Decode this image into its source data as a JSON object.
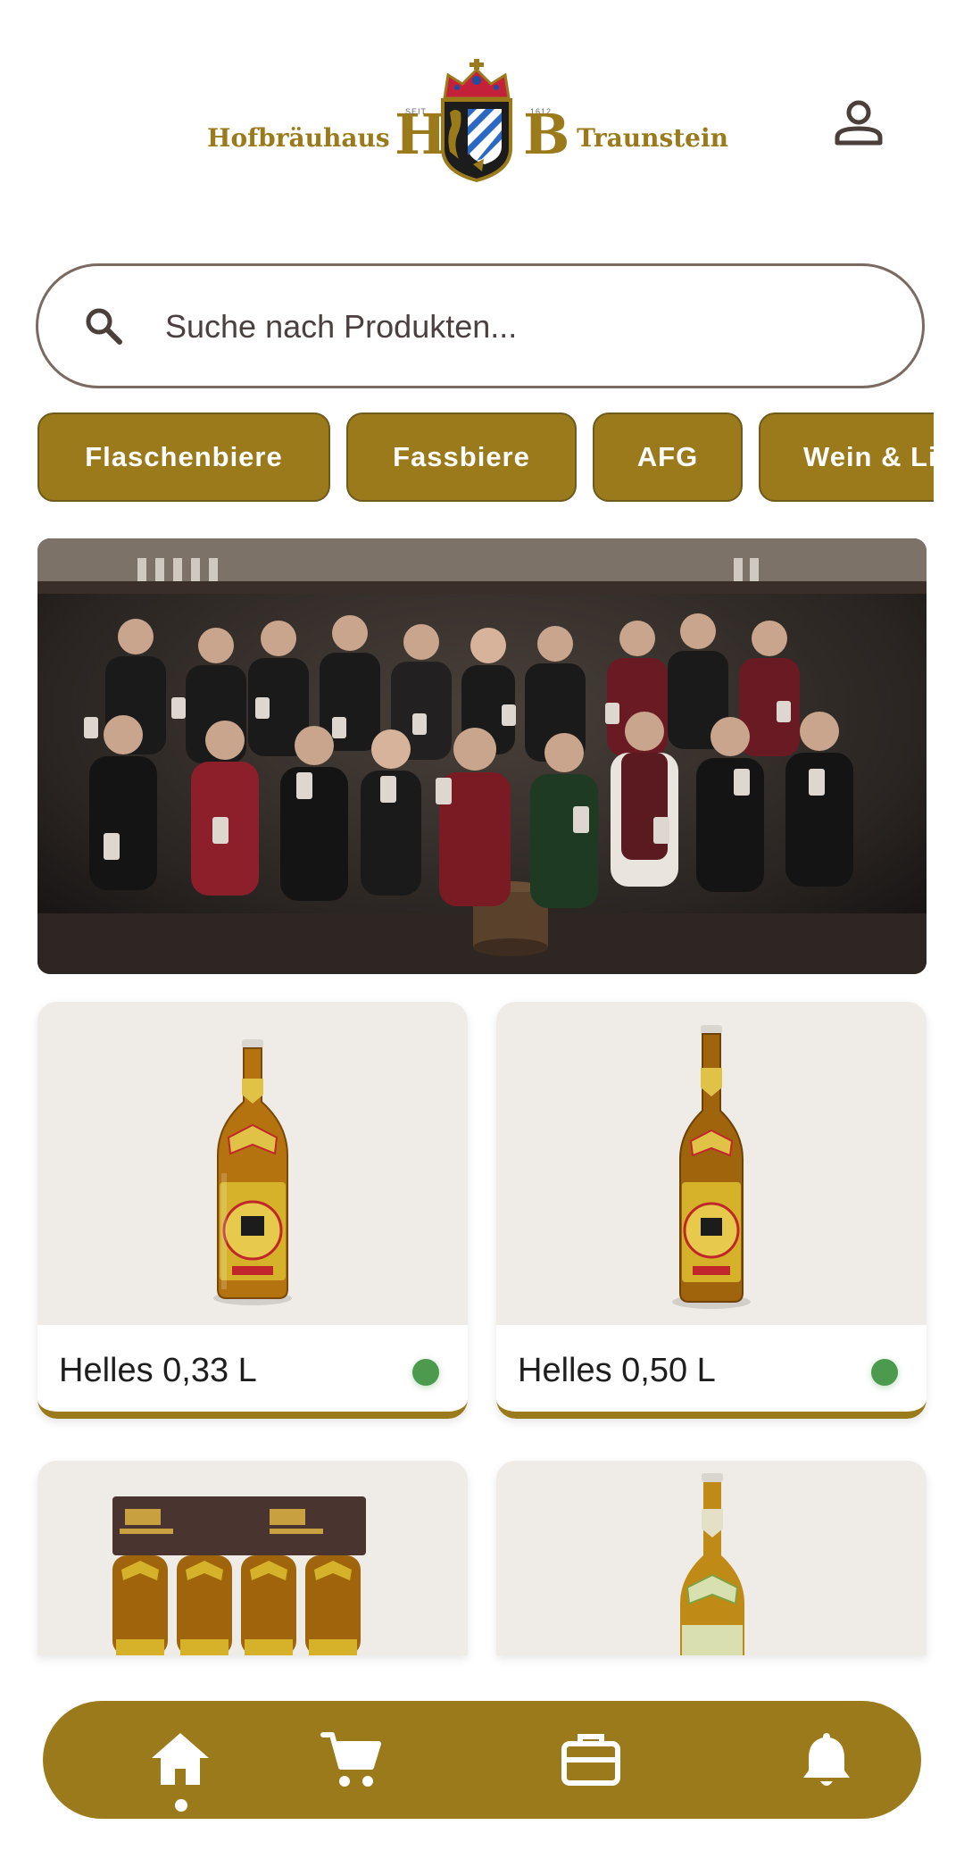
{
  "header": {
    "brand_left": "Hofbräuhaus",
    "brand_right": "Traunstein",
    "brand_h": "H",
    "brand_b": "B",
    "brand_seit": "SEIT",
    "brand_year": "1612",
    "profile_icon": "person-icon"
  },
  "search": {
    "placeholder": "Suche nach Produkten...",
    "icon": "search-icon"
  },
  "categories": [
    {
      "label": "Flaschenbiere"
    },
    {
      "label": "Fassbiere"
    },
    {
      "label": "AFG"
    },
    {
      "label": "Wein & Li"
    }
  ],
  "banner": {
    "alt": "Group photo"
  },
  "products": [
    {
      "name": "Helles 0,33 L",
      "available": true,
      "status_color": "#4b9a4e"
    },
    {
      "name": "Helles 0,50 L",
      "available": true,
      "status_color": "#4b9a4e"
    },
    {
      "name": "",
      "available": true
    },
    {
      "name": "",
      "available": true
    }
  ],
  "nav": {
    "items": [
      {
        "icon": "home-icon",
        "active": true
      },
      {
        "icon": "cart-icon",
        "active": false
      },
      {
        "icon": "briefcase-icon",
        "active": false
      },
      {
        "icon": "bell-icon",
        "active": false
      }
    ]
  },
  "colors": {
    "brand_gold": "#9a7a1b",
    "available_green": "#4b9a4e"
  }
}
